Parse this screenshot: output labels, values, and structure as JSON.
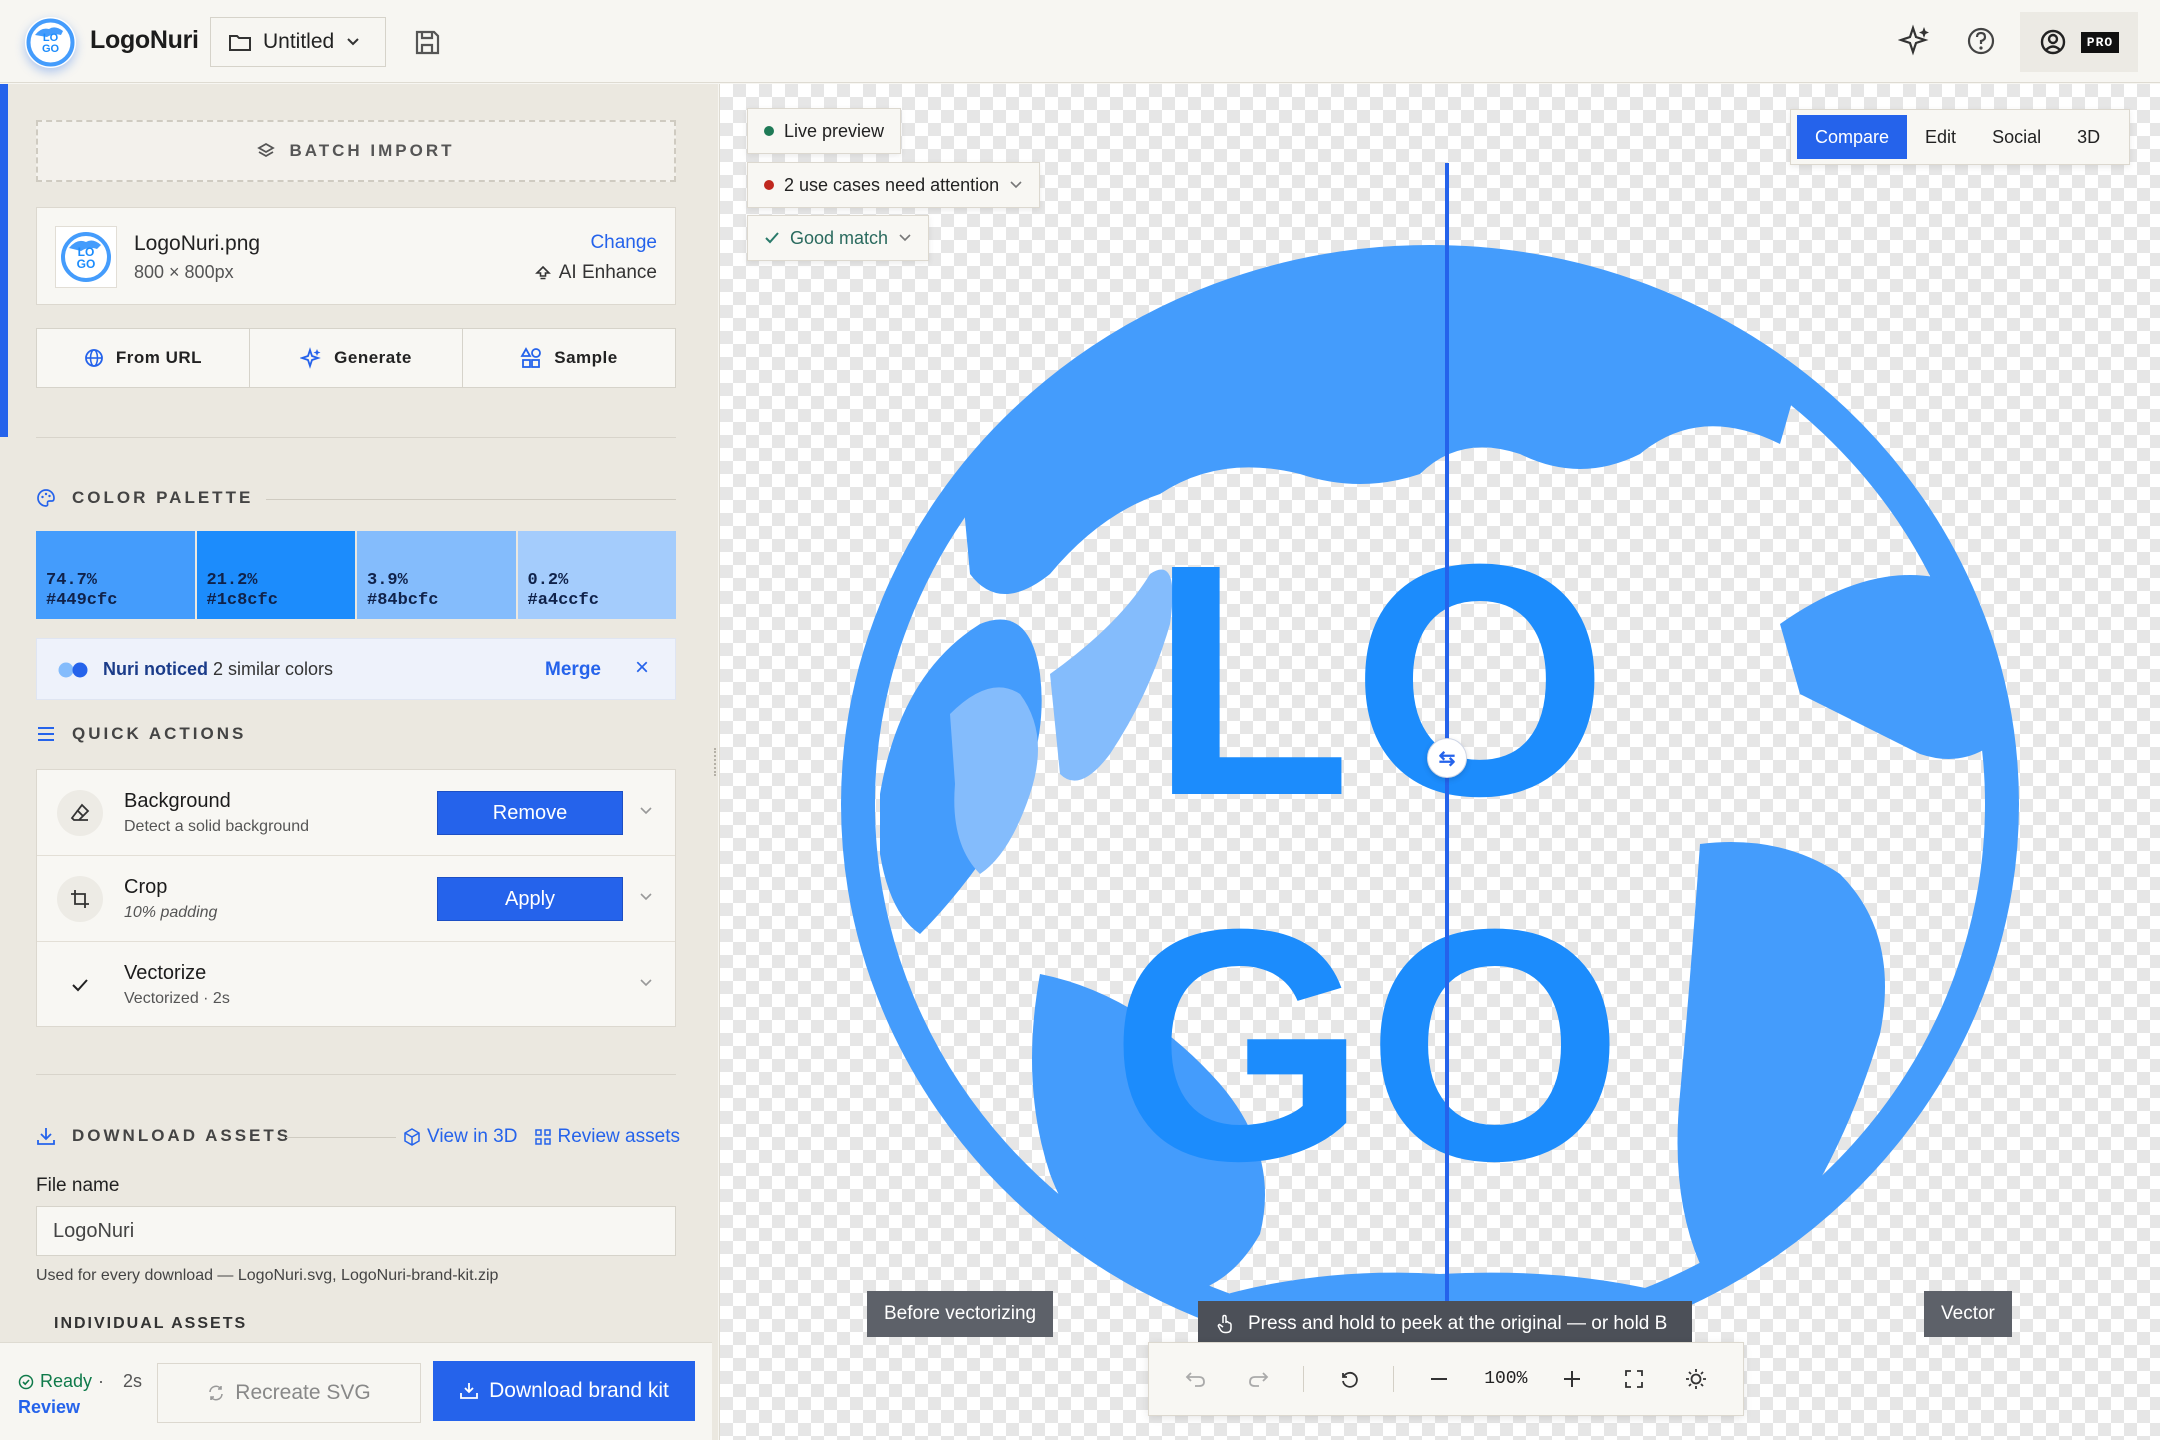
{
  "app": {
    "name": "LogoNuri",
    "project_name": "Untitled"
  },
  "colors": {
    "accent": "#2563eb",
    "logo_blue": "#449cfc",
    "logo_dark": "#1c8cfc"
  },
  "batch_import": {
    "label": "BATCH IMPORT"
  },
  "file": {
    "name": "LogoNuri.png",
    "dimensions": "800 × 800px",
    "change_label": "Change",
    "enhance_label": "AI Enhance"
  },
  "sources": [
    {
      "label": "From URL",
      "icon": "globe-icon"
    },
    {
      "label": "Generate",
      "icon": "sparkle-icon"
    },
    {
      "label": "Sample",
      "icon": "shapes-icon"
    }
  ],
  "palette": {
    "heading": "COLOR PALETTE",
    "swatches": [
      {
        "percent": "74.7%",
        "hex": "#449cfc",
        "color": "#449cfc"
      },
      {
        "percent": "21.2%",
        "hex": "#1c8cfc",
        "color": "#1c8cfc"
      },
      {
        "percent": "3.9%",
        "hex": "#84bcfc",
        "color": "#84bcfc"
      },
      {
        "percent": "0.2%",
        "hex": "#a4ccfc",
        "color": "#a4ccfc"
      }
    ],
    "notice": {
      "title": "Nuri noticed",
      "text": "2 similar colors",
      "action": "Merge"
    }
  },
  "quick_actions": {
    "heading": "QUICK ACTIONS",
    "items": [
      {
        "title": "Background",
        "subtitle": "Detect a solid background",
        "button": "Remove"
      },
      {
        "title": "Crop",
        "subtitle": "10% padding",
        "button": "Apply"
      },
      {
        "title": "Vectorize",
        "subtitle": "Vectorized · 2s"
      }
    ]
  },
  "download": {
    "heading": "DOWNLOAD ASSETS",
    "view_3d": "View in 3D",
    "review_assets": "Review assets",
    "file_name_label": "File name",
    "file_name_value": "LogoNuri",
    "help_text": "Used for every download — LogoNuri.svg, LogoNuri-brand-kit.zip",
    "individual_heading": "INDIVIDUAL ASSETS"
  },
  "footer": {
    "status": "Ready",
    "time": "2s",
    "review": "Review",
    "recreate": "Recreate SVG",
    "download": "Download brand kit"
  },
  "canvas": {
    "live_preview": "Live preview",
    "attention": "2 use cases need attention",
    "match": "Good match",
    "tabs": [
      "Compare",
      "Edit",
      "Social",
      "3D"
    ],
    "active_tab": "Compare",
    "before_label": "Before vectorizing",
    "after_label": "Vector",
    "peek_hint": "Press and hold to peek at the original — or hold B",
    "zoom": "100%",
    "logo_text_top": "LO",
    "logo_text_bottom": "GO"
  }
}
